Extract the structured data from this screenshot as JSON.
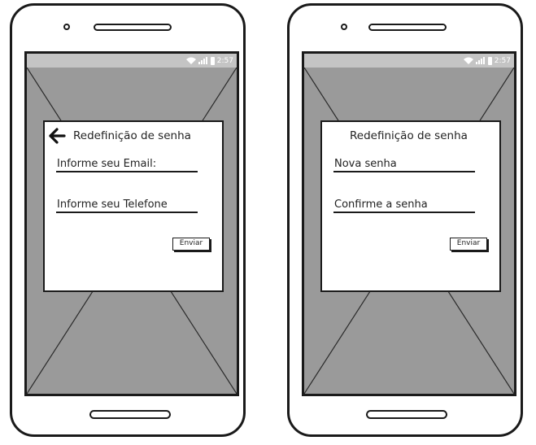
{
  "status_bar": {
    "time": "2:57"
  },
  "screens": [
    {
      "title": "Redefinição de senha",
      "has_back": true,
      "fields": [
        "Informe seu Email:",
        "Informe seu Telefone"
      ],
      "button": "Enviar"
    },
    {
      "title": "Redefinição de senha",
      "has_back": false,
      "fields": [
        "Nova senha",
        "Confirme a senha"
      ],
      "button": "Enviar"
    }
  ],
  "colors": {
    "screen_bg": "#9a9a9a",
    "status_bar": "#c4c4c4",
    "outline": "#1a1a1a"
  }
}
